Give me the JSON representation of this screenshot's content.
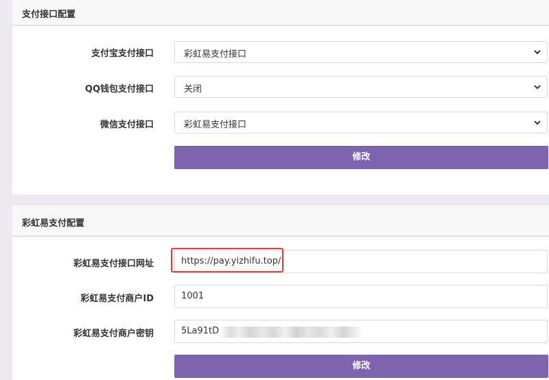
{
  "panel1": {
    "title": "支付接口配置",
    "rows": [
      {
        "label": "支付宝支付接口",
        "value": "彩虹易支付接口"
      },
      {
        "label": "QQ钱包支付接口",
        "value": "关闭"
      },
      {
        "label": "微信支付接口",
        "value": "彩虹易支付接口"
      }
    ],
    "submit_label": "修改"
  },
  "panel2": {
    "title": "彩虹易支付配置",
    "rows": [
      {
        "label": "彩虹易支付接口网址",
        "value": "https://pay.yizhifu.top/"
      },
      {
        "label": "彩虹易支付商户ID",
        "value": "1001"
      },
      {
        "label": "彩虹易支付商户密钥",
        "value": "5La91tD"
      }
    ],
    "submit_label": "修改"
  },
  "colors": {
    "accent": "#7e63ae",
    "highlight": "#e53935",
    "background": "#ece9f1"
  },
  "icons": {
    "select_chevron": "chevron-down-icon"
  }
}
